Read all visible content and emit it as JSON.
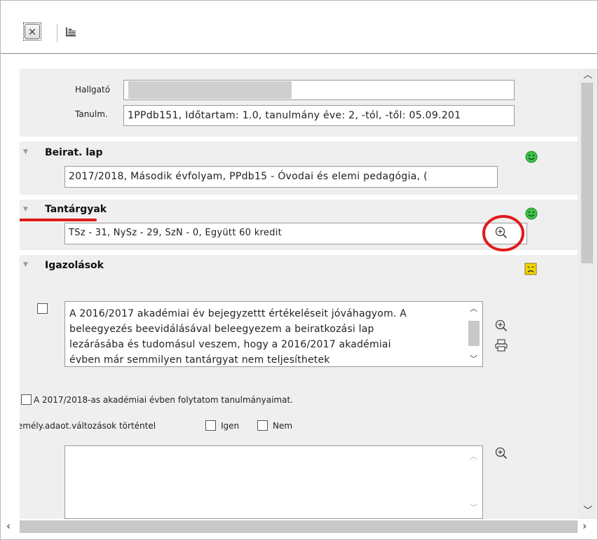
{
  "toolbar": {
    "close_glyph": "×",
    "close_icon": "close-icon",
    "grid_icon": "table-grid-icon"
  },
  "student": {
    "hallgato_label": "Hallgató",
    "hallgato_value": "",
    "tanulm_label": "Tanulm.",
    "tanulm_value": "1PPdb151, Időtartam: 1.0, tanulmány éve: 2,  -tól, -től: 05.09.201"
  },
  "beirat": {
    "title": "Beirat. lap",
    "value": "2017/2018, Második évfolyam, PPdb15 - Óvodai és elemi pedagógia, (",
    "status_icon": "smiley-happy-icon"
  },
  "tantargyak": {
    "title": "Tantárgyak",
    "value": "TSz - 31, NySz - 29, SzN - 0, Együtt 60 kredit",
    "status_icon": "smiley-happy-icon",
    "zoom_icon": "zoom-in-icon"
  },
  "igazolasok": {
    "title": "Igazolások",
    "status_icon": "smiley-sad-icon",
    "declaration_lines": [
      "A  2016/2017 akadémiai év bejegyzettt értékeléseit jóváhagyom. A",
      "beleegyezés beevidálásával beleegyezem a beiratkozási lap",
      "lezárásába és tudomásul veszem, hogy a  2016/2017 akadémiai",
      "évben már semmilyen tantárgyat nem teljesíthetek"
    ],
    "continue_label": "A 2017/2018-as akadémiai évben folytatom tanulmányaimat.",
    "changes_label": "Személy.adaot.változások történtel",
    "igen_label": "Igen",
    "nem_label": "Nem"
  },
  "colors": {
    "section_bg": "#efefef",
    "happy": "#3cc24a",
    "sad": "#f2d600",
    "annotation_red": "#e11a1a"
  }
}
